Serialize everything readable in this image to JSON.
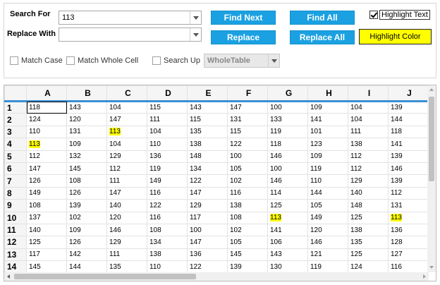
{
  "search": {
    "search_for_label": "Search For",
    "search_for_value": "113",
    "replace_with_label": "Replace With",
    "replace_with_value": ""
  },
  "buttons": {
    "find_next": "Find Next",
    "find_all": "Find All",
    "replace": "Replace",
    "replace_all": "Replace All",
    "highlight_color": "Highlight Color"
  },
  "options": {
    "highlight_text_label": "Highlight Text",
    "highlight_text_checked": true,
    "match_case_label": "Match Case",
    "match_whole_cell_label": "Match Whole Cell",
    "search_up_label": "Search Up",
    "scope_value": "WholeTable"
  },
  "colors": {
    "button_blue": "#1ba1e2",
    "highlight_yellow": "#ffff00",
    "header_accent": "#3a8fd5"
  },
  "grid": {
    "columns": [
      "A",
      "B",
      "C",
      "D",
      "E",
      "F",
      "G",
      "H",
      "I",
      "J"
    ],
    "rows": [
      {
        "num": "1",
        "cells": [
          "118",
          "143",
          "104",
          "115",
          "143",
          "147",
          "100",
          "109",
          "104",
          "139"
        ]
      },
      {
        "num": "2",
        "cells": [
          "124",
          "120",
          "147",
          "111",
          "115",
          "131",
          "133",
          "141",
          "104",
          "144"
        ]
      },
      {
        "num": "3",
        "cells": [
          "110",
          "131",
          "113",
          "104",
          "135",
          "115",
          "119",
          "101",
          "111",
          "118"
        ]
      },
      {
        "num": "4",
        "cells": [
          "113",
          "109",
          "104",
          "110",
          "138",
          "122",
          "118",
          "123",
          "138",
          "141"
        ]
      },
      {
        "num": "5",
        "cells": [
          "112",
          "132",
          "129",
          "136",
          "148",
          "100",
          "146",
          "109",
          "112",
          "139"
        ]
      },
      {
        "num": "6",
        "cells": [
          "147",
          "145",
          "112",
          "119",
          "134",
          "105",
          "100",
          "119",
          "112",
          "146"
        ]
      },
      {
        "num": "7",
        "cells": [
          "126",
          "108",
          "111",
          "149",
          "122",
          "102",
          "146",
          "110",
          "129",
          "139"
        ]
      },
      {
        "num": "8",
        "cells": [
          "149",
          "126",
          "147",
          "116",
          "147",
          "116",
          "114",
          "144",
          "140",
          "112"
        ]
      },
      {
        "num": "9",
        "cells": [
          "108",
          "139",
          "140",
          "122",
          "129",
          "138",
          "125",
          "105",
          "148",
          "131"
        ]
      },
      {
        "num": "10",
        "cells": [
          "137",
          "102",
          "120",
          "116",
          "117",
          "108",
          "113",
          "149",
          "125",
          "113"
        ]
      },
      {
        "num": "11",
        "cells": [
          "140",
          "109",
          "146",
          "108",
          "100",
          "102",
          "141",
          "120",
          "138",
          "136"
        ]
      },
      {
        "num": "12",
        "cells": [
          "125",
          "126",
          "129",
          "134",
          "147",
          "105",
          "106",
          "146",
          "135",
          "128"
        ]
      },
      {
        "num": "13",
        "cells": [
          "117",
          "142",
          "111",
          "138",
          "136",
          "145",
          "143",
          "121",
          "125",
          "127"
        ]
      },
      {
        "num": "14",
        "cells": [
          "145",
          "144",
          "135",
          "110",
          "122",
          "139",
          "130",
          "119",
          "124",
          "116"
        ]
      }
    ],
    "highlighted": [
      [
        2,
        2
      ],
      [
        3,
        0
      ],
      [
        9,
        6
      ],
      [
        9,
        9
      ]
    ],
    "selected": [
      0,
      0
    ]
  }
}
